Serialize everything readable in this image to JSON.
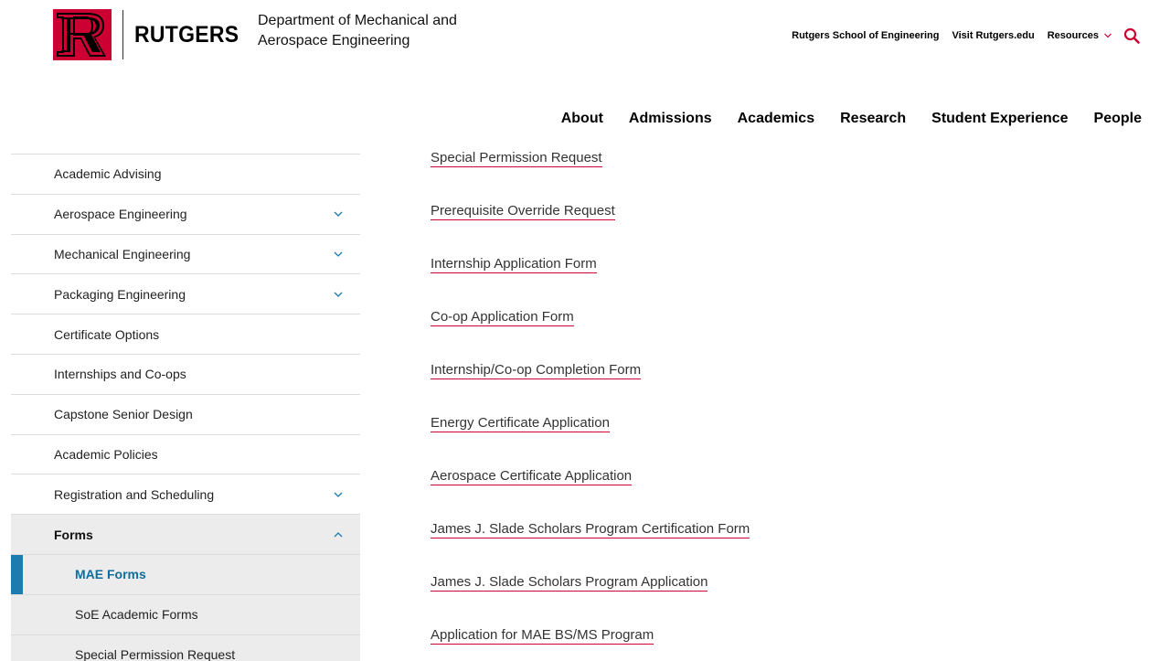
{
  "header": {
    "logo_word": "RUTGERS",
    "department_name": "Department of Mechanical and Aerospace Engineering",
    "brand_color": "#cc0033"
  },
  "utility_nav": {
    "items": [
      "Rutgers School of Engineering",
      "Visit Rutgers.edu"
    ],
    "resources_label": "Resources",
    "search_icon": "search-icon"
  },
  "main_nav": {
    "items": [
      "About",
      "Admissions",
      "Academics",
      "Research",
      "Student Experience",
      "People"
    ]
  },
  "sidebar": {
    "items": [
      {
        "label": "Academic Advising"
      },
      {
        "label": "Aerospace Engineering",
        "expandable": true
      },
      {
        "label": "Mechanical Engineering",
        "expandable": true
      },
      {
        "label": "Packaging Engineering",
        "expandable": true
      },
      {
        "label": "Certificate Options"
      },
      {
        "label": "Internships and Co-ops"
      },
      {
        "label": "Capstone Senior Design"
      },
      {
        "label": "Academic Policies"
      },
      {
        "label": "Registration and Scheduling",
        "expandable": true
      },
      {
        "label": "Forms",
        "expanded": true
      },
      {
        "label": "MAE Forms",
        "current": true
      },
      {
        "label": "SoE Academic Forms"
      },
      {
        "label": "Special Permission Request"
      }
    ],
    "accent_color": "#1e7bb0"
  },
  "content": {
    "links": [
      "Special Permission Request",
      "Prerequisite Override Request",
      "Internship Application Form",
      "Co-op Application Form",
      "Internship/Co-op Completion Form",
      "Energy Certificate Application",
      "Aerospace Certificate Application",
      "James J. Slade Scholars Program Certification Form",
      "James J. Slade Scholars Program Application",
      "Application for MAE BS/MS Program"
    ]
  }
}
